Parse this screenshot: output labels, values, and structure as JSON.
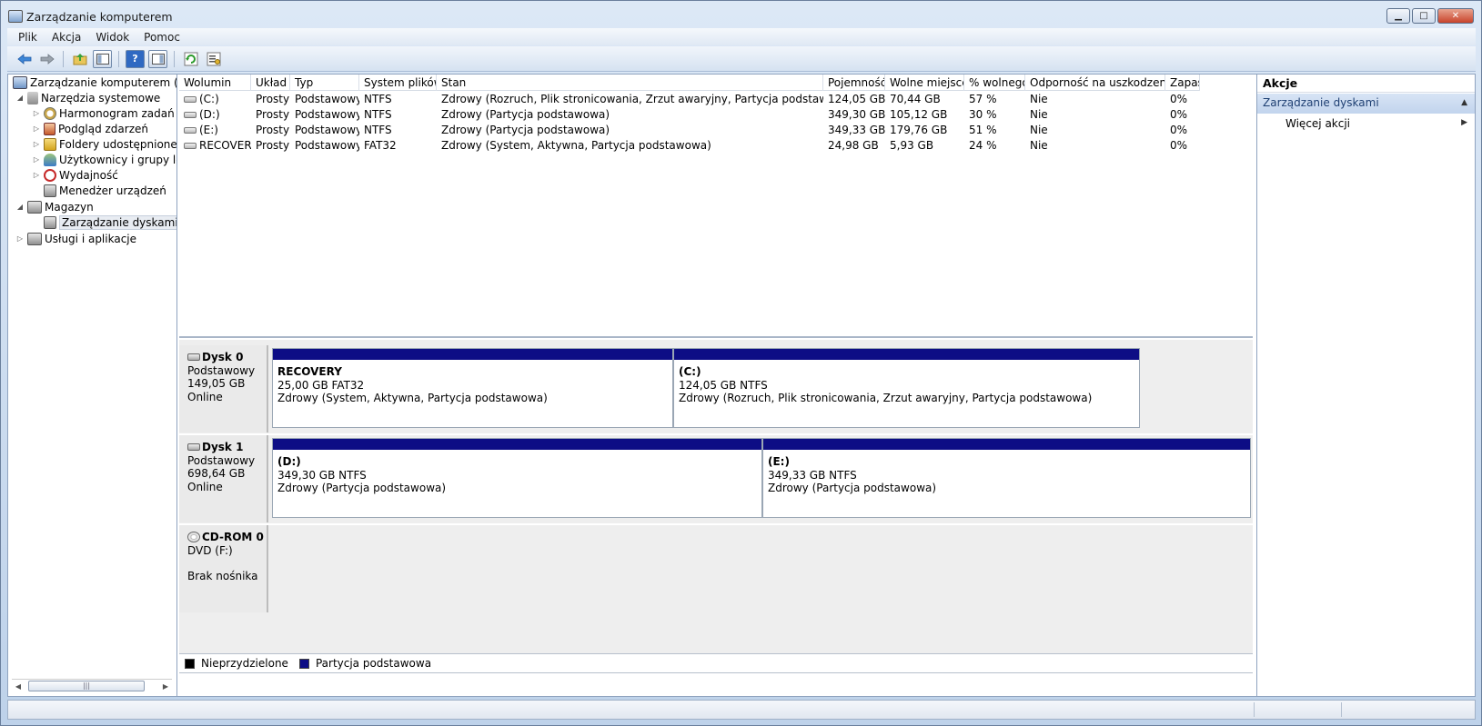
{
  "window": {
    "title": "Zarządzanie komputerem",
    "controls": {
      "minimize": "▁",
      "maximize": "□",
      "close": "✕"
    }
  },
  "menu": [
    "Plik",
    "Akcja",
    "Widok",
    "Pomoc"
  ],
  "toolbar": {
    "buttons": [
      "back-arrow-icon",
      "forward-arrow-icon",
      "up-folder-icon",
      "show-hide-tree-icon",
      "help-icon",
      "show-hide-action-pane-icon",
      "refresh-icon",
      "properties-icon"
    ]
  },
  "tree": {
    "root": "Zarządzanie komputerem (lokalny)",
    "items": [
      {
        "label": "Narzędzia systemowe",
        "level": 1,
        "twisty": "◢"
      },
      {
        "label": "Harmonogram zadań",
        "level": 2,
        "twisty": "▷"
      },
      {
        "label": "Podgląd zdarzeń",
        "level": 2,
        "twisty": "▷"
      },
      {
        "label": "Foldery udostępnione",
        "level": 2,
        "twisty": "▷"
      },
      {
        "label": "Użytkownicy i grupy lokalne",
        "level": 2,
        "twisty": "▷"
      },
      {
        "label": "Wydajność",
        "level": 2,
        "twisty": "▷"
      },
      {
        "label": "Menedżer urządzeń",
        "level": 2,
        "twisty": ""
      },
      {
        "label": "Magazyn",
        "level": 1,
        "twisty": "◢"
      },
      {
        "label": "Zarządzanie dyskami",
        "level": 2,
        "twisty": ""
      },
      {
        "label": "Usługi i aplikacje",
        "level": 1,
        "twisty": "▷"
      }
    ],
    "scroll": {
      "left": "◀",
      "right": "▶",
      "thumb": "|||"
    }
  },
  "volumes": {
    "columns": [
      "Wolumin",
      "Układ",
      "Typ",
      "System plików",
      "Stan",
      "Pojemność",
      "Wolne miejsce",
      "% wolnego",
      "Odporność na uszkodzenia",
      "Zapas"
    ],
    "rows": [
      [
        "(C:)",
        "Prosty",
        "Podstawowy",
        "NTFS",
        "Zdrowy (Rozruch, Plik stronicowania, Zrzut awaryjny, Partycja podstawowa)",
        "124,05 GB",
        "70,44 GB",
        "57 %",
        "Nie",
        "0%"
      ],
      [
        "(D:)",
        "Prosty",
        "Podstawowy",
        "NTFS",
        "Zdrowy (Partycja podstawowa)",
        "349,30 GB",
        "105,12 GB",
        "30 %",
        "Nie",
        "0%"
      ],
      [
        "(E:)",
        "Prosty",
        "Podstawowy",
        "NTFS",
        "Zdrowy (Partycja podstawowa)",
        "349,33 GB",
        "179,76 GB",
        "51 %",
        "Nie",
        "0%"
      ],
      [
        "RECOVERY",
        "Prosty",
        "Podstawowy",
        "FAT32",
        "Zdrowy (System, Aktywna, Partycja podstawowa)",
        "24,98 GB",
        "5,93 GB",
        "24 %",
        "Nie",
        "0%"
      ]
    ]
  },
  "disks": [
    {
      "name": "Dysk 0",
      "type": "Podstawowy",
      "size": "149,05 GB",
      "status": "Online",
      "partitions": [
        {
          "title": "RECOVERY",
          "fs": "25,00 GB FAT32",
          "status": "Zdrowy (System, Aktywna, Partycja podstawowa)"
        },
        {
          "title": "(C:)",
          "fs": "124,05 GB NTFS",
          "status": "Zdrowy (Rozruch, Plik stronicowania, Zrzut awaryjny, Partycja podstawowa)"
        }
      ]
    },
    {
      "name": "Dysk 1",
      "type": "Podstawowy",
      "size": "698,64 GB",
      "status": "Online",
      "partitions": [
        {
          "title": "(D:)",
          "fs": "349,30 GB NTFS",
          "status": "Zdrowy (Partycja podstawowa)"
        },
        {
          "title": "(E:)",
          "fs": "349,33 GB NTFS",
          "status": "Zdrowy (Partycja podstawowa)"
        }
      ]
    },
    {
      "name": "CD-ROM 0",
      "type": "DVD (F:)",
      "size": "",
      "status": "Brak nośnika",
      "partitions": []
    }
  ],
  "legend": [
    {
      "label": "Nieprzydzielone",
      "color": "#000000"
    },
    {
      "label": "Partycja podstawowa",
      "color": "#0d0d85"
    }
  ],
  "actions": {
    "header": "Akcje",
    "section": "Zarządzanie dyskami",
    "section_arrow": "▲",
    "more": "Więcej akcji",
    "more_arrow": "▶"
  }
}
